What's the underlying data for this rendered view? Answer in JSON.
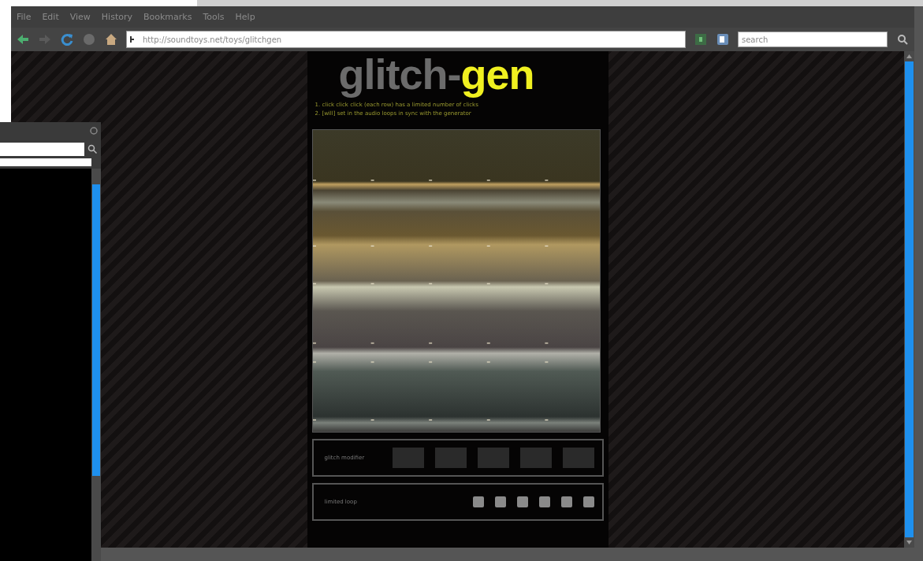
{
  "menu": [
    {
      "label": "File"
    },
    {
      "label": "Edit"
    },
    {
      "label": "View"
    },
    {
      "label": "History"
    },
    {
      "label": "Bookmarks"
    },
    {
      "label": "Tools"
    },
    {
      "label": "Help"
    }
  ],
  "toolbar": {
    "url": "http://soundtoys.net/toys/glitchgen",
    "search": {
      "placeholder": "search"
    }
  },
  "page": {
    "title_part_1": "glitch-",
    "title_part_2": "gen",
    "instructions": [
      "1. click click click (each row) has a limited number of clicks",
      "2. [will] set in the audio loops in sync with the generator"
    ],
    "modifier_panel": {
      "label": "glitch modifier"
    },
    "loop_panel": {
      "label": "limited loop"
    }
  }
}
